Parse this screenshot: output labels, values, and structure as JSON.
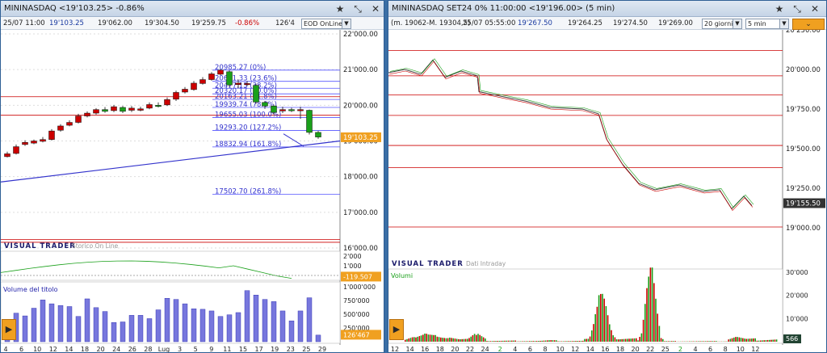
{
  "left": {
    "title": "MININASDAQ <19'103.25> -0.86%",
    "info": {
      "date": "25/07 11:00",
      "last": "19'103.25",
      "v1": "19'062.00",
      "v2": "19'304.50",
      "v3": "19'259.75",
      "chg": "-0.86%",
      "v4": "126'4",
      "source": "EOD OnLine"
    },
    "price_axis": [
      "22'000.00",
      "21'000.00",
      "20'000.00",
      "19'000.00",
      "18'000.00",
      "17'000.00",
      "16'000.00"
    ],
    "last_price_tag": "19'103.25",
    "fib_labels": [
      "20985.27 (0%)",
      "20671.33 (23.6%)",
      "20477.13 (38.2%)",
      "20320.17 (50.0%)",
      "20163.21 (61.8%)",
      "19939.74 (78.6%)",
      "19655.03 (100.0%)",
      "19293.20 (127.2%)",
      "18832.94 (161.8%)",
      "17502.70 (261.8%)"
    ],
    "brand": "VISUAL TRADER",
    "brand_sub": "Storico On Line",
    "osc_axis": [
      "2'000",
      "1'000"
    ],
    "osc_tag": "-119.507",
    "volume_label": "Volume del titolo",
    "volume_axis": [
      "1'000'000",
      "750'000",
      "500'000",
      "250'000"
    ],
    "volume_tag": "126'467",
    "x_labels": [
      "4",
      "6",
      "10",
      "12",
      "14",
      "18",
      "20",
      "24",
      "26",
      "28",
      "Lug",
      "3",
      "5",
      "9",
      "11",
      "15",
      "17",
      "19",
      "23",
      "25",
      "29"
    ],
    "candles": [
      [
        18640,
        18560,
        18700,
        18540
      ],
      [
        18840,
        18650,
        18900,
        18620
      ],
      [
        18960,
        18900,
        19020,
        18860
      ],
      [
        19000,
        18940,
        19040,
        18910
      ],
      [
        19040,
        18990,
        19110,
        18960
      ],
      [
        19280,
        19040,
        19330,
        19010
      ],
      [
        19420,
        19300,
        19470,
        19260
      ],
      [
        19520,
        19440,
        19580,
        19410
      ],
      [
        19700,
        19520,
        19760,
        19490
      ],
      [
        19780,
        19700,
        19830,
        19660
      ],
      [
        19880,
        19780,
        19920,
        19740
      ],
      [
        19830,
        19880,
        19950,
        19790
      ],
      [
        19960,
        19850,
        20010,
        19810
      ],
      [
        19830,
        19940,
        19980,
        19780
      ],
      [
        19920,
        19860,
        19980,
        19810
      ],
      [
        19900,
        19860,
        19960,
        19830
      ],
      [
        20020,
        19920,
        20080,
        19890
      ],
      [
        20000,
        20000,
        20080,
        19940
      ],
      [
        20160,
        20010,
        20220,
        19980
      ],
      [
        20360,
        20170,
        20410,
        20120
      ],
      [
        20450,
        20370,
        20510,
        20330
      ],
      [
        20620,
        20440,
        20680,
        20410
      ],
      [
        20720,
        20610,
        20790,
        20580
      ],
      [
        20880,
        20720,
        20930,
        20690
      ],
      [
        20985,
        20870,
        21010,
        20840
      ],
      [
        20570,
        20940,
        20985,
        20520
      ],
      [
        20620,
        20580,
        20720,
        20480
      ],
      [
        20610,
        20590,
        20680,
        20540
      ],
      [
        20090,
        20560,
        20600,
        20040
      ],
      [
        19980,
        20080,
        20120,
        19900
      ],
      [
        19800,
        19980,
        20020,
        19740
      ],
      [
        19880,
        19840,
        19960,
        19780
      ],
      [
        19860,
        19880,
        19930,
        19810
      ],
      [
        19880,
        19870,
        19960,
        19620
      ],
      [
        19240,
        19860,
        19880,
        19180
      ],
      [
        19110,
        19240,
        19280,
        19060
      ]
    ],
    "volumes": [
      120000,
      520000,
      470000,
      610000,
      760000,
      690000,
      660000,
      640000,
      460000,
      780000,
      620000,
      550000,
      350000,
      360000,
      480000,
      480000,
      420000,
      580000,
      790000,
      770000,
      690000,
      600000,
      590000,
      560000,
      460000,
      490000,
      530000,
      930000,
      850000,
      770000,
      730000,
      560000,
      380000,
      560000,
      800000,
      120000
    ]
  },
  "right": {
    "title": "MININASDAQ SET24 0% 11:00:00 <19'196.00> (5 min)",
    "info": {
      "range": "(m. 19062-M. 19304,5)",
      "date": "25/07 05:55:00",
      "last": "19'267.50",
      "v1": "19'264.25",
      "v2": "19'274.50",
      "v3": "19'269.00",
      "period": "20 giorni",
      "interval": "5 min"
    },
    "price_axis": [
      "20'250.00",
      "20'000.00",
      "19'750.00",
      "19'500.00",
      "19'250.00",
      "19'000.00"
    ],
    "last_price_tag": "19'155.50",
    "brand": "VISUAL TRADER",
    "brand_sub": "Dati Intraday",
    "volume_label": "Volumi",
    "volume_axis": [
      "30'000",
      "20'000",
      "10'000"
    ],
    "volume_tag": "566",
    "x_labels": [
      "12",
      "14",
      "16",
      "18",
      "20",
      "22",
      "24",
      "2",
      "4",
      "6",
      "8",
      "10",
      "12",
      "14",
      "16",
      "18",
      "20",
      "22",
      "25",
      "2",
      "4",
      "6",
      "8",
      "10",
      "12"
    ]
  },
  "colors": {
    "accent": "#f0a020",
    "red": "#cc0000",
    "green": "#1aa01a",
    "blue": "#3333cc",
    "fib": "#5555ff"
  },
  "icons": [
    "star-icon",
    "pin-icon",
    "close-icon",
    "chevron-down-icon",
    "chevron-right-icon"
  ]
}
